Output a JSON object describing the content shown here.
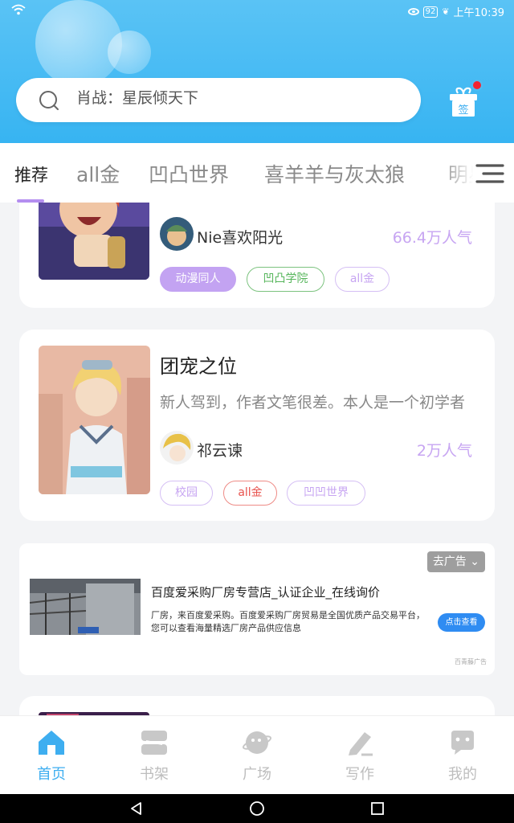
{
  "status_bar": {
    "battery": "92",
    "time": "上午10:39"
  },
  "search": {
    "placeholder": "肖战：星辰倾天下"
  },
  "tabs": [
    {
      "label": "推荐",
      "active": true
    },
    {
      "label": "all金"
    },
    {
      "label": "凹凸世界"
    },
    {
      "label": "喜羊羊与灰太狼"
    },
    {
      "label": "明星"
    }
  ],
  "books": [
    {
      "author": "Nie喜欢阳光",
      "popularity": "66.4万人气",
      "tags": [
        {
          "label": "动漫同人",
          "color": "#b28ef0",
          "filled": true
        },
        {
          "label": "凹凸学院",
          "color": "#55b55a"
        },
        {
          "label": "all金",
          "color": "#c7a5f2"
        }
      ]
    },
    {
      "title": "团宠之位",
      "description": "新人驾到，作者文笔很差。本人是一个初学者",
      "author": "祁云谏",
      "popularity": "2万人气",
      "tags": [
        {
          "label": "校园",
          "color": "#c7a5f2"
        },
        {
          "label": "all金",
          "color": "#e8534e"
        },
        {
          "label": "凹凹世界",
          "color": "#c7a5f2"
        }
      ]
    }
  ],
  "ad": {
    "go_label": "去广告",
    "title": "百度爱采购厂房专营店_认证企业_在线询价",
    "description": "厂房，来百度爱采购。百度爱采购厂房贸易是全国优质产品交易平台，您可以查看海量精选厂房产品供应信息",
    "button": "点击查看",
    "mark": "百青藤广告"
  },
  "bottom_nav": [
    {
      "label": "首页",
      "icon": "home-icon",
      "active": true
    },
    {
      "label": "书架",
      "icon": "bookshelf-icon"
    },
    {
      "label": "广场",
      "icon": "plaza-icon"
    },
    {
      "label": "写作",
      "icon": "write-icon"
    },
    {
      "label": "我的",
      "icon": "profile-icon"
    }
  ],
  "gift_icon_text": "签",
  "colors": {
    "accent": "#3eaef0",
    "purple": "#b48ef0",
    "header": "#4bbcf4"
  }
}
